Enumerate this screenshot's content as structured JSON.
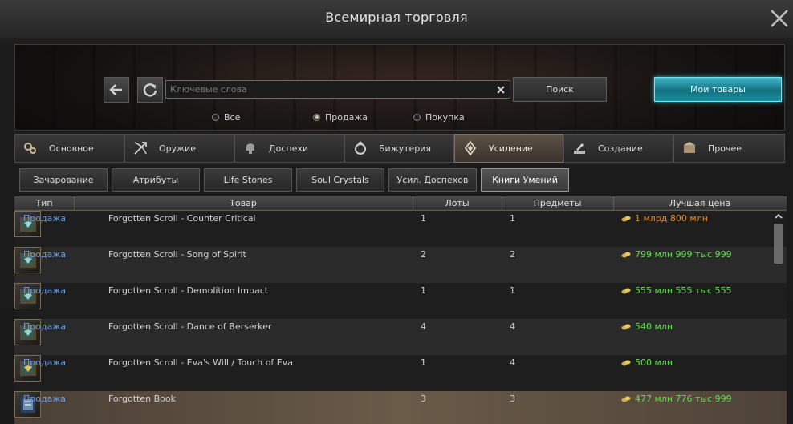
{
  "window": {
    "title": "Всемирная торговля"
  },
  "search": {
    "placeholder": "Ключевые слова",
    "search_label": "Поиск",
    "my_items_label": "Мои товары"
  },
  "filters": {
    "all": "Все",
    "sell": "Продажа",
    "buy": "Покупка",
    "selected": "Продажа"
  },
  "categories": [
    {
      "label": "Основное",
      "icon": "basic-icon"
    },
    {
      "label": "Оружие",
      "icon": "weapon-icon"
    },
    {
      "label": "Доспехи",
      "icon": "armor-icon"
    },
    {
      "label": "Бижутерия",
      "icon": "jewelry-icon"
    },
    {
      "label": "Усиление",
      "icon": "enhancement-icon",
      "active": true
    },
    {
      "label": "Создание",
      "icon": "crafting-icon"
    },
    {
      "label": "Прочее",
      "icon": "misc-icon"
    }
  ],
  "subcategories": [
    {
      "label": "Зачарование"
    },
    {
      "label": "Атрибуты"
    },
    {
      "label": "Life Stones"
    },
    {
      "label": "Soul Crystals"
    },
    {
      "label": "Усил. Доспехов"
    },
    {
      "label": "Книги Умений",
      "active": true
    }
  ],
  "table": {
    "columns": [
      "Тип",
      "Товар",
      "Лоты",
      "Предметы",
      "Лучшая цена"
    ],
    "rows": [
      {
        "type": "Продажа",
        "name": "Forgotten Scroll - Counter Critical",
        "lots": "1",
        "items": "1",
        "price": "1 млрд 800 млн",
        "price_color": "#e0892e"
      },
      {
        "type": "Продажа",
        "name": "Forgotten Scroll - Song of Spirit",
        "lots": "2",
        "items": "2",
        "price": "799 млн 999 тыс 999",
        "price_color": "#5ee04a"
      },
      {
        "type": "Продажа",
        "name": "Forgotten Scroll - Demolition Impact",
        "lots": "1",
        "items": "1",
        "price": "555 млн 555 тыс 555",
        "price_color": "#5ee04a"
      },
      {
        "type": "Продажа",
        "name": "Forgotten Scroll - Dance of Berserker",
        "lots": "4",
        "items": "4",
        "price": "540 млн",
        "price_color": "#5ee04a"
      },
      {
        "type": "Продажа",
        "name": "Forgotten Scroll - Eva's Will / Touch of Eva",
        "lots": "1",
        "items": "4",
        "price": "500 млн",
        "price_color": "#5ee04a"
      },
      {
        "type": "Продажа",
        "name": "Forgotten Book",
        "lots": "3",
        "items": "3",
        "price": "477 млн 776 тыс 999",
        "price_color": "#5ee04a"
      }
    ]
  },
  "colors": {
    "link": "#6b9ee0",
    "accent": "#3fb6c8"
  }
}
